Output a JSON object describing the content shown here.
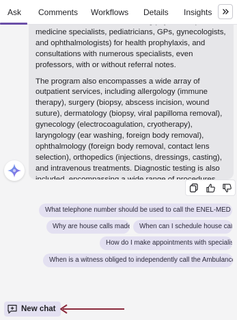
{
  "tabs": [
    {
      "label": "Ask",
      "active": true
    },
    {
      "label": "Comments"
    },
    {
      "label": "Workflows"
    },
    {
      "label": "Details"
    },
    {
      "label": "Insights"
    }
  ],
  "more_icon": "double-chevron-right-icon",
  "message": {
    "paragraphs": [
      "cities, consultations with attending physicians (internal medicine specialists, pediatricians, GPs, gynecologists, and ophthalmologists) for health prophylaxis, and consultations with numerous specialists, even professors, with or without referral notes.",
      "The program also encompasses a wide array of outpatient services, including allergology (immune therapy), surgery (biopsy, abscess incision, wound suture), dermatology (biopsy, viral papilloma removal), gynecology (electrocoagulation, cryotherapy), laryngology (ear washing, foreign body removal), ophthalmology (foreign body removal, contact lens selection), orthopedics (injections, dressings, casting), and intravenous treatments. Diagnostic testing is also included, encompassing a wide range of procedures"
    ]
  },
  "message_actions": [
    "copy-icon",
    "thumbs-up-icon",
    "thumbs-down-icon"
  ],
  "suggestions": [
    "What telephone number should be used to call the ENEL-MED am...",
    "Why are house calls made?",
    "When can I schedule house calls?",
    "How do I make appointments with specialists?",
    "When is a witness obliged to independently call the Ambulance S..."
  ],
  "new_chat_label": "New chat",
  "colors": {
    "accent": "#6b4fa8",
    "chip_bg": "#e3e0f1",
    "bubble_bg": "#e6e6e9",
    "arrow": "#8b2a3c"
  }
}
